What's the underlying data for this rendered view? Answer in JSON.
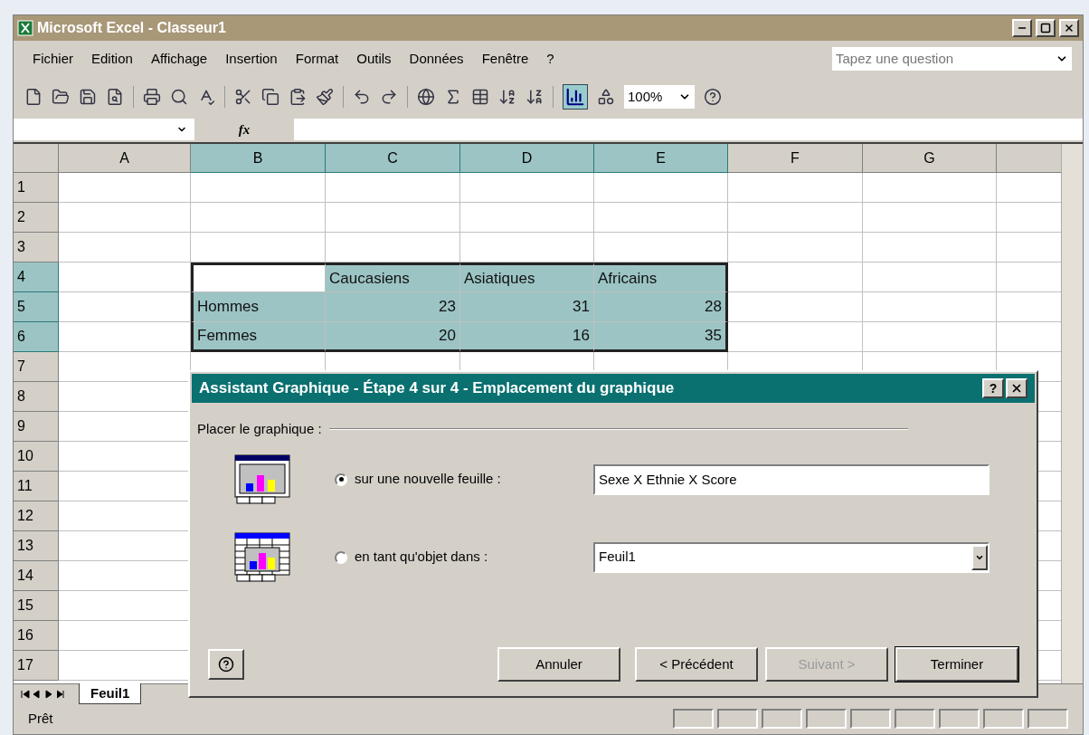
{
  "window": {
    "title": "Microsoft Excel - Classeur1"
  },
  "menu": [
    "Fichier",
    "Edition",
    "Affichage",
    "Insertion",
    "Format",
    "Outils",
    "Données",
    "Fenêtre",
    "?"
  ],
  "question_box": {
    "placeholder": "Tapez une question"
  },
  "toolbar": {
    "zoom": "100%"
  },
  "formula_bar": {
    "fx": "fx"
  },
  "columns": [
    {
      "label": "A",
      "selected": false
    },
    {
      "label": "B",
      "selected": true
    },
    {
      "label": "C",
      "selected": true
    },
    {
      "label": "D",
      "selected": true
    },
    {
      "label": "E",
      "selected": true
    },
    {
      "label": "F",
      "selected": false
    },
    {
      "label": "G",
      "selected": false
    }
  ],
  "rows": [
    {
      "label": "1",
      "selected": false
    },
    {
      "label": "2",
      "selected": false
    },
    {
      "label": "3",
      "selected": false
    },
    {
      "label": "4",
      "selected": true,
      "cells": [
        null,
        {
          "active": true
        },
        {
          "text": "Caucasiens",
          "kind": "text"
        },
        {
          "text": "Asiatiques",
          "kind": "text"
        },
        {
          "text": "Africains",
          "kind": "text"
        },
        null,
        null
      ]
    },
    {
      "label": "5",
      "selected": true,
      "cells": [
        null,
        {
          "text": "Hommes",
          "kind": "text"
        },
        {
          "text": "23",
          "kind": "number"
        },
        {
          "text": "31",
          "kind": "number"
        },
        {
          "text": "28",
          "kind": "number"
        },
        null,
        null
      ]
    },
    {
      "label": "6",
      "selected": true,
      "cells": [
        null,
        {
          "text": "Femmes",
          "kind": "text"
        },
        {
          "text": "20",
          "kind": "number"
        },
        {
          "text": "16",
          "kind": "number"
        },
        {
          "text": "35",
          "kind": "number"
        },
        null,
        null
      ]
    },
    {
      "label": "7",
      "selected": false
    },
    {
      "label": "8",
      "selected": false
    },
    {
      "label": "9",
      "selected": false
    },
    {
      "label": "10",
      "selected": false
    },
    {
      "label": "11",
      "selected": false
    },
    {
      "label": "12",
      "selected": false
    },
    {
      "label": "13",
      "selected": false
    },
    {
      "label": "14",
      "selected": false
    },
    {
      "label": "15",
      "selected": false
    },
    {
      "label": "16",
      "selected": false
    },
    {
      "label": "17",
      "selected": false
    }
  ],
  "sheet_tabs": [
    {
      "label": "Feuil1",
      "selected": true
    }
  ],
  "status_bar": "Prêt",
  "dialog": {
    "title": "Assistant Graphique - Étape 4 sur 4 - Emplacement du graphique",
    "help": "?",
    "group_label": "Placer le graphique :",
    "options": [
      {
        "label": "sur une nouvelle feuille :",
        "selected": true,
        "kind": "sheet",
        "field": {
          "kind": "text",
          "value": "Sexe X Ethnie X Score"
        }
      },
      {
        "label": "en tant qu'objet dans :",
        "selected": false,
        "kind": "object",
        "field": {
          "kind": "dropdown",
          "value": "Feuil1"
        }
      }
    ],
    "buttons": [
      {
        "label": "Annuler",
        "disabled": false,
        "default": false
      },
      {
        "label": "< Précédent",
        "disabled": false,
        "default": false
      },
      {
        "label": "Suivant >",
        "disabled": true,
        "default": false
      },
      {
        "label": "Terminer",
        "disabled": false,
        "default": true
      }
    ]
  }
}
